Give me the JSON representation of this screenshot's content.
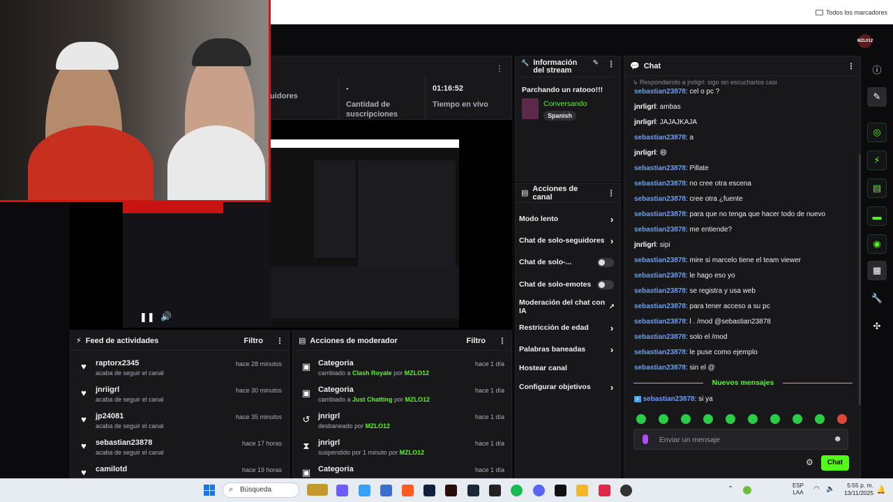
{
  "browser": {
    "bookmarks_folder": "Todos los marcadores"
  },
  "header": {
    "avatar": "MZL012"
  },
  "stats": {
    "followers_label": "uidores",
    "subs_value": "-",
    "subs_label": "Cantidad de suscripciones",
    "live_value": "01:16:52",
    "live_label": "Tiempo en vivo"
  },
  "info": {
    "title": "Información del stream",
    "stream_title": "Parchando un ratooo!!!",
    "category": "Conversando",
    "language": "Spanish"
  },
  "actions": {
    "title": "Acciones de canal",
    "items": [
      {
        "label": "Modo lento",
        "control": "chevron"
      },
      {
        "label": "Chat de solo-seguidores",
        "control": "chevron"
      },
      {
        "label": "Chat de solo-...",
        "control": "toggle"
      },
      {
        "label": "Chat de solo-emotes",
        "control": "toggle"
      },
      {
        "label": "Moderación del chat con IA",
        "control": "external"
      },
      {
        "label": "Restricción de edad",
        "control": "chevron"
      },
      {
        "label": "Palabras baneadas",
        "control": "chevron"
      },
      {
        "label": "Hostear canal",
        "control": "none"
      },
      {
        "label": "Configurar objetivos",
        "control": "chevron"
      }
    ]
  },
  "feed": {
    "title": "Feed de actividades",
    "filter": "Filtro",
    "items": [
      {
        "name": "raptorx2345",
        "sub": "acaba de seguir el canal",
        "time": "hace 28 minutos"
      },
      {
        "name": "jnriigrl",
        "sub": "acaba de seguir el canal",
        "time": "hace 30 minutos"
      },
      {
        "name": "jp24081",
        "sub": "acaba de seguir el canal",
        "time": "hace 35 minutos"
      },
      {
        "name": "sebastian23878",
        "sub": "acaba de seguir el canal",
        "time": "hace 17 horas"
      },
      {
        "name": "camilotd",
        "sub": "",
        "time": "hace 19 horas"
      }
    ]
  },
  "mod": {
    "title": "Acciones de moderador",
    "filter": "Filtro",
    "items": [
      {
        "name": "Categoria",
        "pre": "cambiado a ",
        "g1": "Clash Royale",
        "mid": " por ",
        "g2": "MZLO12",
        "time": "hace 1 día"
      },
      {
        "name": "Categoria",
        "pre": "cambiado a ",
        "g1": "Just Chatting",
        "mid": " por ",
        "g2": "MZLO12",
        "time": "hace 1 día"
      },
      {
        "name": "jnrigrl",
        "pre": "desbaneado por ",
        "g1": "MZLO12",
        "mid": "",
        "g2": "",
        "time": "hace 1 día"
      },
      {
        "name": "jnrigrl",
        "pre": "suspendido por 1 minuto por ",
        "g1": "MZLO12",
        "mid": "",
        "g2": "",
        "time": "hace 1 día"
      },
      {
        "name": "Categoria",
        "pre": "",
        "g1": "",
        "mid": "",
        "g2": "",
        "time": "hace 1 día"
      }
    ]
  },
  "chat": {
    "title": "Chat",
    "reply": "Respondiendo a jnrligrl: sigo sin escucharlos casi",
    "new_messages": "Nuevos mensajes",
    "input_placeholder": "Enviar un mensaje",
    "send": "Chat",
    "messages": [
      {
        "user": "sebastian23878",
        "text": ": cel o pc ?",
        "blue": true
      },
      {
        "user": "jnrligrl",
        "text": ": ambas",
        "blue": false
      },
      {
        "user": "jnrligrl",
        "text": ": JAJAJKAJA",
        "blue": false
      },
      {
        "user": "sebastian23878",
        "text": ": a",
        "blue": true
      },
      {
        "user": "jnrligrl",
        "text": ": 😄",
        "blue": false
      },
      {
        "user": "sebastian23878",
        "text": ": Pillate",
        "blue": true
      },
      {
        "user": "sebastian23878",
        "text": ": no cree otra escena",
        "blue": true
      },
      {
        "user": "sebastian23878",
        "text": ": cree otra ¿fuente",
        "blue": true
      },
      {
        "user": "sebastian23878",
        "text": ": para que no tenga que hacer todo de nuevo",
        "blue": true
      },
      {
        "user": "sebastian23878",
        "text": ": me entiende?",
        "blue": true
      },
      {
        "user": "jnrligrl",
        "text": ": sipi",
        "blue": false
      },
      {
        "user": "sebastian23878",
        "text": ": mire si marcelo tiene el team viewer",
        "blue": true
      },
      {
        "user": "sebastian23878",
        "text": ": le hago eso yo",
        "blue": true
      },
      {
        "user": "sebastian23878",
        "text": ": se registra y usa web",
        "blue": true
      },
      {
        "user": "sebastian23878",
        "text": ": para tener acceso a su pc",
        "blue": true
      },
      {
        "user": "sebastian23878",
        "text": ": l . /mod @sebastian23878",
        "blue": true
      },
      {
        "user": "sebastian23878",
        "text": ": solo el /mod",
        "blue": true
      },
      {
        "user": "sebastian23878",
        "text": ": le puse como ejemplo",
        "blue": true
      },
      {
        "user": "sebastian23878",
        "text": ": sin el @",
        "blue": true
      }
    ],
    "last": {
      "user": "sebastian23878",
      "text": ": si ya"
    }
  },
  "taskbar": {
    "search": "Búsqueda",
    "lang": "ESP",
    "lang2": "LAA",
    "time": "5:55 p. m.",
    "date": "13/11/2025"
  }
}
